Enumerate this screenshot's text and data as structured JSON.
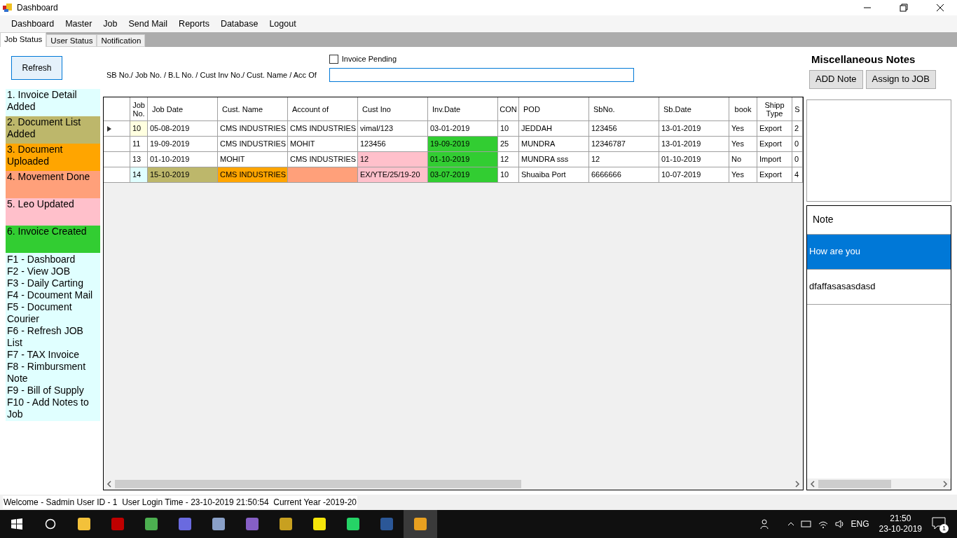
{
  "window": {
    "title": "Dashboard"
  },
  "menu": [
    "Dashboard",
    "Master",
    "Job",
    "Send Mail",
    "Reports",
    "Database",
    "Logout"
  ],
  "tabs": [
    {
      "label": "Job Status",
      "selected": true
    },
    {
      "label": "User Status",
      "selected": false
    },
    {
      "label": "Notification",
      "selected": false
    }
  ],
  "refresh_button": "Refresh",
  "search": {
    "label": "SB No./ Job No. / B.L No. / Cust Inv No./ Cust. Name / Acc Of",
    "invoice_pending": {
      "label": "Invoice Pending",
      "checked": false
    }
  },
  "legend": [
    {
      "label": "1. Invoice Detail Added",
      "color": "#e0ffff"
    },
    {
      "label": "2. Document List Added",
      "color": "#bdb76b"
    },
    {
      "label": "3. Document Uploaded",
      "color": "#ffa500"
    },
    {
      "label": "4. Movement Done",
      "color": "#ffa07a"
    },
    {
      "label": "5. Leo Updated",
      "color": "#ffc0cb"
    },
    {
      "label": "6. Invoice Created",
      "color": "#32cd32"
    }
  ],
  "shortcuts": [
    "F1 - Dashboard",
    "F2 - View JOB",
    "F3 - Daily Carting",
    "F4 - Dcoument Mail",
    "F5 - Document Courier",
    "F6 - Refresh JOB List",
    "F7 - TAX Invoice",
    "F8 - Rimbursment Note",
    "F9 - Bill of Supply",
    "F10 - Add Notes to Job"
  ],
  "table": {
    "columns": [
      "Job No.",
      "Job Date",
      "Cust. Name",
      "Account of",
      "Cust Ino",
      "Inv.Date",
      "CON",
      "POD",
      "SbNo.",
      "Sb.Date",
      "book",
      "Shipp Type",
      "S"
    ],
    "rows": [
      {
        "selected": true,
        "cells": [
          {
            "text": "10",
            "color": "#ffffe0"
          },
          {
            "text": "05-08-2019"
          },
          {
            "text": "CMS INDUSTRIES"
          },
          {
            "text": "CMS INDUSTRIES"
          },
          {
            "text": "vimal/123"
          },
          {
            "text": "03-01-2019"
          },
          {
            "text": "10"
          },
          {
            "text": "JEDDAH"
          },
          {
            "text": "123456"
          },
          {
            "text": "13-01-2019"
          },
          {
            "text": "Yes"
          },
          {
            "text": "Export"
          },
          {
            "text": "2"
          }
        ]
      },
      {
        "selected": false,
        "cells": [
          {
            "text": "11"
          },
          {
            "text": "19-09-2019"
          },
          {
            "text": "CMS INDUSTRIES"
          },
          {
            "text": "MOHIT"
          },
          {
            "text": "123456"
          },
          {
            "text": "19-09-2019",
            "color": "#32cd32"
          },
          {
            "text": "25"
          },
          {
            "text": "MUNDRA"
          },
          {
            "text": "12346787"
          },
          {
            "text": "13-01-2019"
          },
          {
            "text": "Yes"
          },
          {
            "text": "Export"
          },
          {
            "text": "0"
          }
        ]
      },
      {
        "selected": false,
        "cells": [
          {
            "text": "13"
          },
          {
            "text": "01-10-2019"
          },
          {
            "text": "MOHIT"
          },
          {
            "text": "CMS INDUSTRIES"
          },
          {
            "text": "12",
            "color": "#ffc0cb"
          },
          {
            "text": "01-10-2019",
            "color": "#32cd32"
          },
          {
            "text": "12"
          },
          {
            "text": "MUNDRA sss"
          },
          {
            "text": "12"
          },
          {
            "text": "01-10-2019"
          },
          {
            "text": "No"
          },
          {
            "text": "Import"
          },
          {
            "text": "0"
          }
        ]
      },
      {
        "selected": false,
        "cells": [
          {
            "text": "14",
            "color": "#e0ffff"
          },
          {
            "text": "15-10-2019",
            "color": "#bdb76b"
          },
          {
            "text": "CMS INDUSTRIES",
            "color": "#ffa500"
          },
          {
            "color": "#ffa07a"
          },
          {
            "text": "EX/YTE/25/19-20",
            "color": "#ffc0cb"
          },
          {
            "text": "03-07-2019",
            "color": "#32cd32"
          },
          {
            "text": "10"
          },
          {
            "text": "Shuaiba Port"
          },
          {
            "text": "6666666"
          },
          {
            "text": "10-07-2019"
          },
          {
            "text": "Yes"
          },
          {
            "text": "Export"
          },
          {
            "text": "4"
          }
        ]
      }
    ]
  },
  "notes": {
    "title": "Miscellaneous Notes",
    "buttons": [
      "ADD Note",
      "Assign to JOB"
    ],
    "list_header": "Note",
    "items": [
      {
        "text": "How are you",
        "selected": true
      },
      {
        "text": "dfaffasasasdasd",
        "selected": false
      }
    ]
  },
  "status_bar": "Welcome - Sadmin User ID - 1  User Login Time - 23-10-2019 21:50:54  Current Year -2019-20",
  "taskbar": {
    "language": "ENG",
    "time": "21:50",
    "date": "23-10-2019",
    "notification_count": "1"
  }
}
